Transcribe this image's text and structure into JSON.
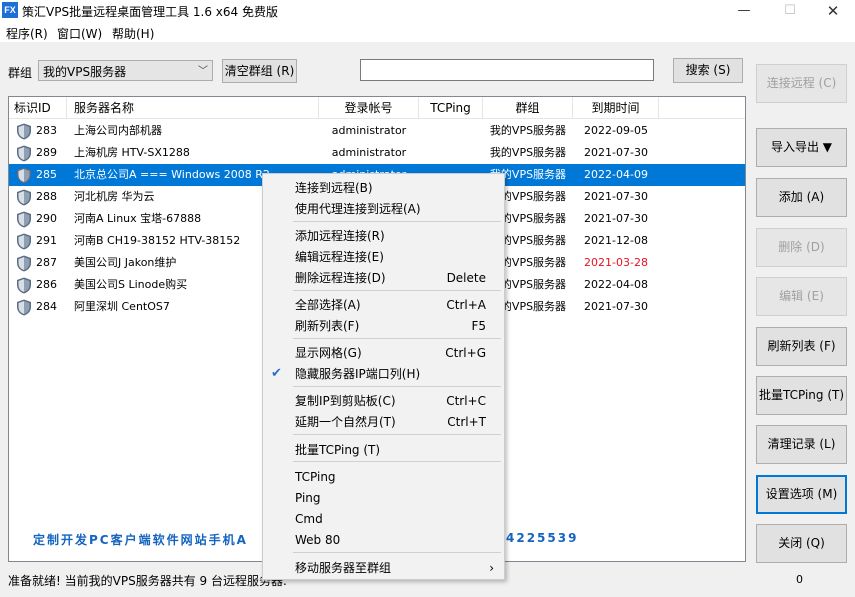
{
  "window": {
    "title": "策汇VPS批量远程桌面管理工具  1.6 x64 免费版",
    "icon": "FX"
  },
  "menu": [
    "程序(R)",
    "窗口(W)",
    "帮助(H)"
  ],
  "toolbar": {
    "group_label": "群组",
    "group_value": "我的VPS服务器",
    "clear_button": "清空群组 (R)",
    "search_value": "",
    "search_button": "搜索 (S)"
  },
  "columns": [
    "标识ID",
    "服务器名称",
    "登录帐号",
    "TCPing",
    "群组",
    "到期时间"
  ],
  "rows": [
    {
      "id": "283",
      "name": "上海公司内部机器",
      "account": "administrator",
      "tcping": "",
      "group": "我的VPS服务器",
      "expiry": "2022-09-05",
      "expired": false
    },
    {
      "id": "289",
      "name": "上海机房  HTV-SX1288",
      "account": "administrator",
      "tcping": "",
      "group": "我的VPS服务器",
      "expiry": "2021-07-30",
      "expired": false
    },
    {
      "id": "285",
      "name": "北京总公司A   === Windows 2008 R2 ===",
      "account": "administrator",
      "tcping": "",
      "group": "我的VPS服务器",
      "expiry": "2022-04-09",
      "expired": false
    },
    {
      "id": "288",
      "name": "河北机房  华为云",
      "account": "",
      "tcping": "",
      "group": "我的VPS服务器",
      "expiry": "2021-07-30",
      "expired": false
    },
    {
      "id": "290",
      "name": "河南A   Linux 宝塔-67888",
      "account": "",
      "tcping": "",
      "group": "我的VPS服务器",
      "expiry": "2021-07-30",
      "expired": false
    },
    {
      "id": "291",
      "name": "河南B  CH19-38152   HTV-38152",
      "account": "",
      "tcping": "",
      "group": "我的VPS服务器",
      "expiry": "2021-12-08",
      "expired": false
    },
    {
      "id": "287",
      "name": "美国公司J  Jakon维护",
      "account": "",
      "tcping": "",
      "group": "我的VPS服务器",
      "expiry": "2021-03-28",
      "expired": true
    },
    {
      "id": "286",
      "name": "美国公司S  Linode购买",
      "account": "",
      "tcping": "",
      "group": "我的VPS服务器",
      "expiry": "2022-04-08",
      "expired": false
    },
    {
      "id": "284",
      "name": "阿里深圳   CentOS7",
      "account": "",
      "tcping": "",
      "group": "我的VPS服务器",
      "expiry": "2021-07-30",
      "expired": false
    }
  ],
  "ad_text": "定制开发PC客户端软件网站手机A",
  "ad_tail": "4225539",
  "side_buttons": [
    {
      "label": "连接远程 (C)",
      "disabled": true
    },
    {
      "label": "导入导出 ▼",
      "disabled": false
    },
    {
      "label": "添加 (A)",
      "disabled": false
    },
    {
      "label": "删除 (D)",
      "disabled": true
    },
    {
      "label": "编辑 (E)",
      "disabled": true
    },
    {
      "label": "刷新列表 (F)",
      "disabled": false
    },
    {
      "label": "批量TCPing (T)",
      "disabled": false
    },
    {
      "label": "清理记录 (L)",
      "disabled": false
    },
    {
      "label": "设置选项 (M)",
      "disabled": false
    },
    {
      "label": "关闭 (Q)",
      "disabled": false
    }
  ],
  "status": {
    "text": "准备就绪! 当前我的VPS服务器共有 9 台远程服务器.",
    "count": "0"
  },
  "context_menu": [
    {
      "label": "连接到远程(B)",
      "shortcut": ""
    },
    {
      "label": "使用代理连接到远程(A)",
      "shortcut": ""
    },
    {
      "label": "添加远程连接(R)",
      "shortcut": ""
    },
    {
      "label": "编辑远程连接(E)",
      "shortcut": ""
    },
    {
      "label": "删除远程连接(D)",
      "shortcut": "Delete"
    },
    {
      "label": "全部选择(A)",
      "shortcut": "Ctrl+A"
    },
    {
      "label": "刷新列表(F)",
      "shortcut": "F5"
    },
    {
      "label": "显示网格(G)",
      "shortcut": "Ctrl+G"
    },
    {
      "label": "隐藏服务器IP端口列(H)",
      "shortcut": "",
      "checked": true
    },
    {
      "label": "复制IP到剪贴板(C)",
      "shortcut": "Ctrl+C"
    },
    {
      "label": "延期一个自然月(T)",
      "shortcut": "Ctrl+T"
    },
    {
      "label": "批量TCPing (T)",
      "shortcut": ""
    },
    {
      "label": "TCPing",
      "shortcut": ""
    },
    {
      "label": "Ping",
      "shortcut": ""
    },
    {
      "label": "Cmd",
      "shortcut": ""
    },
    {
      "label": "Web 80",
      "shortcut": ""
    },
    {
      "label": "移动服务器至群组",
      "shortcut": "",
      "submenu": true
    }
  ],
  "colors": {
    "selection": "#0078d7",
    "expired": "#e81123",
    "ad": "#1565c0",
    "shield": "#5a6b82"
  }
}
